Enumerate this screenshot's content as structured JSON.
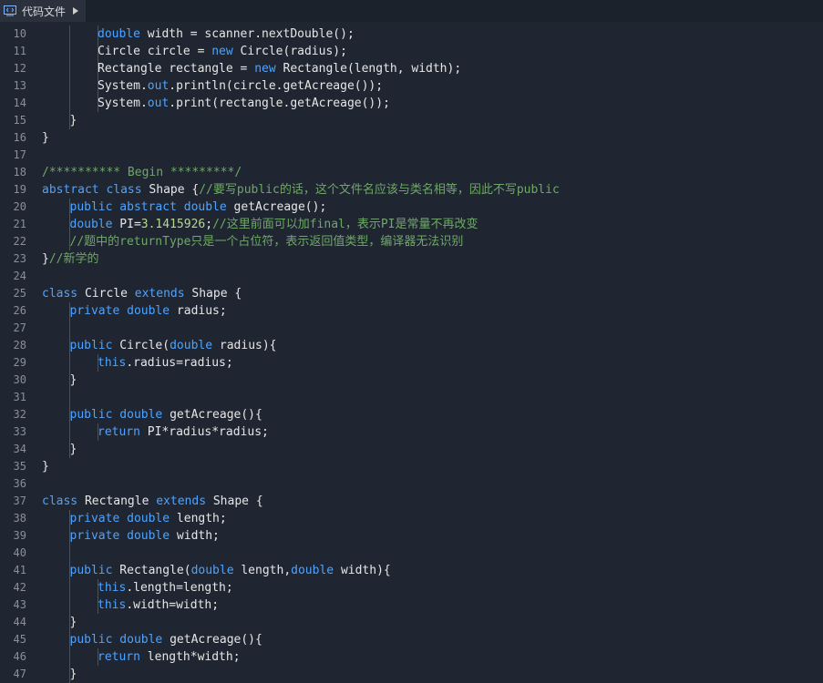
{
  "tab": {
    "label": "代码文件"
  },
  "lines": [
    {
      "n": "10",
      "indent": 2,
      "tokens": [
        {
          "t": "double",
          "k": "kw"
        },
        {
          "t": " width = scanner.nextDouble();",
          "k": ""
        }
      ]
    },
    {
      "n": "11",
      "indent": 2,
      "tokens": [
        {
          "t": "Circle circle = ",
          "k": ""
        },
        {
          "t": "new",
          "k": "kw"
        },
        {
          "t": " Circle(radius);",
          "k": ""
        }
      ]
    },
    {
      "n": "12",
      "indent": 2,
      "tokens": [
        {
          "t": "Rectangle rectangle = ",
          "k": ""
        },
        {
          "t": "new",
          "k": "kw"
        },
        {
          "t": " Rectangle(length, width);",
          "k": ""
        }
      ]
    },
    {
      "n": "13",
      "indent": 2,
      "tokens": [
        {
          "t": "System.",
          "k": ""
        },
        {
          "t": "out",
          "k": "kw"
        },
        {
          "t": ".println(circle.getAcreage());",
          "k": ""
        }
      ]
    },
    {
      "n": "14",
      "indent": 2,
      "tokens": [
        {
          "t": "System.",
          "k": ""
        },
        {
          "t": "out",
          "k": "kw"
        },
        {
          "t": ".print(rectangle.getAcreage());",
          "k": ""
        }
      ]
    },
    {
      "n": "15",
      "indent": 1,
      "tokens": [
        {
          "t": "}",
          "k": ""
        }
      ]
    },
    {
      "n": "16",
      "indent": 0,
      "tokens": [
        {
          "t": "}",
          "k": ""
        }
      ]
    },
    {
      "n": "17",
      "indent": 0,
      "tokens": []
    },
    {
      "n": "18",
      "indent": 0,
      "tokens": [
        {
          "t": "/********** Begin *********/",
          "k": "cm"
        }
      ]
    },
    {
      "n": "19",
      "indent": 0,
      "tokens": [
        {
          "t": "abstract",
          "k": "kw"
        },
        {
          "t": " ",
          "k": ""
        },
        {
          "t": "class",
          "k": "kw"
        },
        {
          "t": " Shape {",
          "k": ""
        },
        {
          "t": "//要写public的话，这个文件名应该与类名相等，因此不写public",
          "k": "cm"
        }
      ]
    },
    {
      "n": "20",
      "indent": 1,
      "tokens": [
        {
          "t": "public",
          "k": "kw"
        },
        {
          "t": " ",
          "k": ""
        },
        {
          "t": "abstract",
          "k": "kw"
        },
        {
          "t": " ",
          "k": ""
        },
        {
          "t": "double",
          "k": "kw"
        },
        {
          "t": " getAcreage();",
          "k": ""
        }
      ]
    },
    {
      "n": "21",
      "indent": 1,
      "tokens": [
        {
          "t": "double",
          "k": "kw"
        },
        {
          "t": " PI=",
          "k": ""
        },
        {
          "t": "3.1415926",
          "k": "cn"
        },
        {
          "t": ";",
          "k": ""
        },
        {
          "t": "//这里前面可以加final，表示PI是常量不再改变",
          "k": "cm"
        }
      ]
    },
    {
      "n": "22",
      "indent": 1,
      "tokens": [
        {
          "t": "//题中的returnType只是一个占位符，表示返回值类型，编译器无法识别",
          "k": "cm"
        }
      ]
    },
    {
      "n": "23",
      "indent": 0,
      "tokens": [
        {
          "t": "}",
          "k": ""
        },
        {
          "t": "//新学的",
          "k": "cm"
        }
      ]
    },
    {
      "n": "24",
      "indent": 0,
      "tokens": []
    },
    {
      "n": "25",
      "indent": 0,
      "tokens": [
        {
          "t": "class",
          "k": "kw"
        },
        {
          "t": " Circle ",
          "k": ""
        },
        {
          "t": "extends",
          "k": "kw"
        },
        {
          "t": " Shape {",
          "k": ""
        }
      ]
    },
    {
      "n": "26",
      "indent": 1,
      "tokens": [
        {
          "t": "private",
          "k": "kw"
        },
        {
          "t": " ",
          "k": ""
        },
        {
          "t": "double",
          "k": "kw"
        },
        {
          "t": " radius;",
          "k": ""
        }
      ]
    },
    {
      "n": "27",
      "indent": 1,
      "tokens": []
    },
    {
      "n": "28",
      "indent": 1,
      "tokens": [
        {
          "t": "public",
          "k": "kw"
        },
        {
          "t": " Circle(",
          "k": ""
        },
        {
          "t": "double",
          "k": "kw"
        },
        {
          "t": " radius){",
          "k": ""
        }
      ]
    },
    {
      "n": "29",
      "indent": 2,
      "tokens": [
        {
          "t": "this",
          "k": "kw"
        },
        {
          "t": ".radius=radius;",
          "k": ""
        }
      ]
    },
    {
      "n": "30",
      "indent": 1,
      "tokens": [
        {
          "t": "}",
          "k": ""
        }
      ]
    },
    {
      "n": "31",
      "indent": 1,
      "tokens": []
    },
    {
      "n": "32",
      "indent": 1,
      "tokens": [
        {
          "t": "public",
          "k": "kw"
        },
        {
          "t": " ",
          "k": ""
        },
        {
          "t": "double",
          "k": "kw"
        },
        {
          "t": " getAcreage(){",
          "k": ""
        }
      ]
    },
    {
      "n": "33",
      "indent": 2,
      "tokens": [
        {
          "t": "return",
          "k": "kw"
        },
        {
          "t": " PI*radius*radius;",
          "k": ""
        }
      ]
    },
    {
      "n": "34",
      "indent": 1,
      "tokens": [
        {
          "t": "}",
          "k": ""
        }
      ]
    },
    {
      "n": "35",
      "indent": 0,
      "tokens": [
        {
          "t": "}",
          "k": ""
        }
      ]
    },
    {
      "n": "36",
      "indent": 0,
      "tokens": []
    },
    {
      "n": "37",
      "indent": 0,
      "tokens": [
        {
          "t": "class",
          "k": "kw"
        },
        {
          "t": " Rectangle ",
          "k": ""
        },
        {
          "t": "extends",
          "k": "kw"
        },
        {
          "t": " Shape {",
          "k": ""
        }
      ]
    },
    {
      "n": "38",
      "indent": 1,
      "tokens": [
        {
          "t": "private",
          "k": "kw"
        },
        {
          "t": " ",
          "k": ""
        },
        {
          "t": "double",
          "k": "kw"
        },
        {
          "t": " length;",
          "k": ""
        }
      ]
    },
    {
      "n": "39",
      "indent": 1,
      "tokens": [
        {
          "t": "private",
          "k": "kw"
        },
        {
          "t": " ",
          "k": ""
        },
        {
          "t": "double",
          "k": "kw"
        },
        {
          "t": " width;",
          "k": ""
        }
      ]
    },
    {
      "n": "40",
      "indent": 1,
      "tokens": []
    },
    {
      "n": "41",
      "indent": 1,
      "tokens": [
        {
          "t": "public",
          "k": "kw"
        },
        {
          "t": " Rectangle(",
          "k": ""
        },
        {
          "t": "double",
          "k": "kw"
        },
        {
          "t": " length,",
          "k": ""
        },
        {
          "t": "double",
          "k": "kw"
        },
        {
          "t": " width){",
          "k": ""
        }
      ]
    },
    {
      "n": "42",
      "indent": 2,
      "tokens": [
        {
          "t": "this",
          "k": "kw"
        },
        {
          "t": ".length=length;",
          "k": ""
        }
      ]
    },
    {
      "n": "43",
      "indent": 2,
      "tokens": [
        {
          "t": "this",
          "k": "kw"
        },
        {
          "t": ".width=width;",
          "k": ""
        }
      ]
    },
    {
      "n": "44",
      "indent": 1,
      "tokens": [
        {
          "t": "}",
          "k": ""
        }
      ]
    },
    {
      "n": "45",
      "indent": 1,
      "tokens": [
        {
          "t": "public",
          "k": "kw"
        },
        {
          "t": " ",
          "k": ""
        },
        {
          "t": "double",
          "k": "kw"
        },
        {
          "t": " getAcreage(){",
          "k": ""
        }
      ]
    },
    {
      "n": "46",
      "indent": 2,
      "tokens": [
        {
          "t": "return",
          "k": "kw"
        },
        {
          "t": " length*width;",
          "k": ""
        }
      ]
    },
    {
      "n": "47",
      "indent": 1,
      "tokens": [
        {
          "t": "}",
          "k": ""
        }
      ]
    }
  ],
  "colors": {
    "background": "#1f2631",
    "keyword": "#4da3ff",
    "comment": "#6ea866",
    "number": "#b8d78f",
    "text": "#e6e6e6",
    "line_number": "#8a8f98"
  }
}
